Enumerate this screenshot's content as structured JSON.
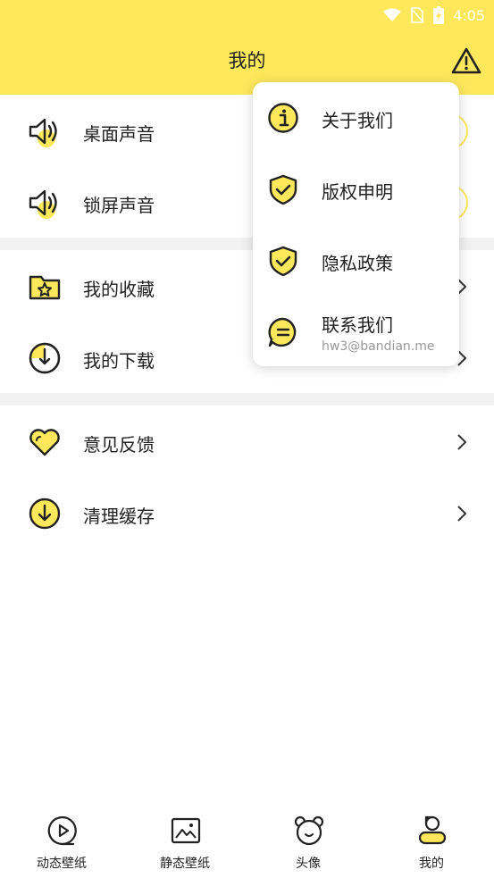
{
  "status_bar": {
    "time": "4:05"
  },
  "header": {
    "title": "我的"
  },
  "colors": {
    "accent": "#FDE85C",
    "icon_stroke": "#222222"
  },
  "settings_sound": [
    {
      "label": "桌面声音",
      "icon": "speaker-icon"
    },
    {
      "label": "锁屏声音",
      "icon": "speaker-icon"
    }
  ],
  "menu_user": [
    {
      "label": "我的收藏",
      "icon": "star-folder-icon"
    },
    {
      "label": "我的下载",
      "icon": "download-clock-icon"
    }
  ],
  "menu_other": [
    {
      "label": "意见反馈",
      "icon": "heart-icon"
    },
    {
      "label": "清理缓存",
      "icon": "clean-download-icon"
    }
  ],
  "popup": {
    "items": [
      {
        "label": "关于我们",
        "icon": "info-icon"
      },
      {
        "label": "版权申明",
        "icon": "shield-check-icon"
      },
      {
        "label": "隐私政策",
        "icon": "shield-check-icon"
      },
      {
        "label": "联系我们",
        "sub": "hw3@bandian.me",
        "icon": "chat-bubble-icon"
      }
    ]
  },
  "tabbar": {
    "items": [
      {
        "label": "动态壁纸",
        "icon": "play-icon"
      },
      {
        "label": "静态壁纸",
        "icon": "picture-icon"
      },
      {
        "label": "头像",
        "icon": "bear-face-icon"
      },
      {
        "label": "我的",
        "icon": "person-icon"
      }
    ]
  }
}
